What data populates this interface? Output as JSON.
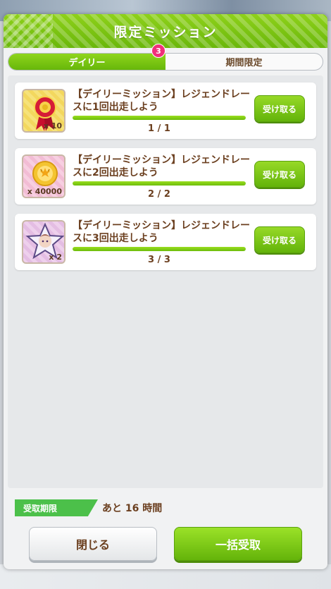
{
  "dialog": {
    "title": "限定ミッション"
  },
  "tabs": [
    {
      "label": "デイリー",
      "active": true,
      "badge": "3"
    },
    {
      "label": "期間限定",
      "active": false
    }
  ],
  "missions": [
    {
      "title": "【デイリーミッション】レジェンドレースに1回出走しよう",
      "progress_text": "1 / 1",
      "progress": 1.0,
      "reward_icon": "rosette-icon",
      "reward_count": "x 10",
      "claim_label": "受け取る"
    },
    {
      "title": "【デイリーミッション】レジェンドレースに2回出走しよう",
      "progress_text": "2 / 2",
      "progress": 1.0,
      "reward_icon": "gold-coin-icon",
      "reward_count": "x 40000",
      "claim_label": "受け取る"
    },
    {
      "title": "【デイリーミッション】レジェンドレースに3回出走しよう",
      "progress_text": "3 / 3",
      "progress": 1.0,
      "reward_icon": "character-star-icon",
      "reward_count": "x 2",
      "claim_label": "受け取る"
    }
  ],
  "footer": {
    "deadline_label": "受取期限",
    "deadline_value": "あと 16 時間",
    "close_label": "閉じる",
    "claim_all_label": "一括受取"
  },
  "colors": {
    "accent_green": "#6ab70b",
    "text_brown": "#6b3f1f",
    "badge_pink": "#f0307a"
  }
}
